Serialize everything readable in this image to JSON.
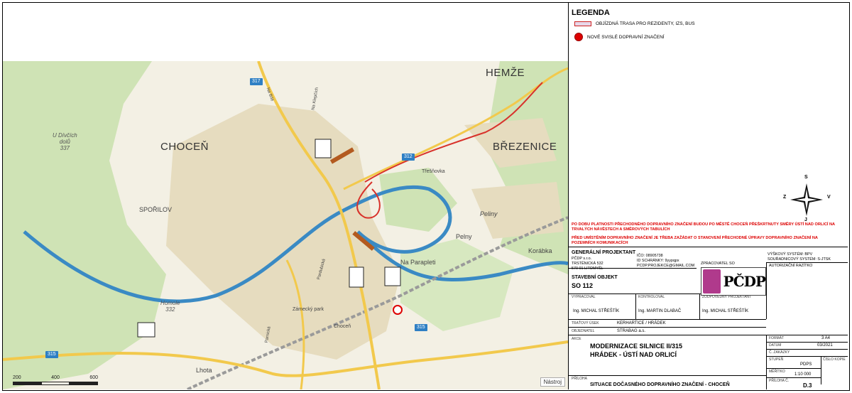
{
  "legend": {
    "title": "LEGENDA",
    "items": [
      {
        "label": "OBJÍZDNÁ TRASA PRO REZIDENTY, IZS, BUS"
      },
      {
        "label": "NOVÉ SVISLÉ DOPRAVNÍ ZNAČENÍ"
      }
    ]
  },
  "compass": {
    "z": "Z",
    "v": "V",
    "s": "S",
    "j": "J"
  },
  "notes": [
    "PO DOBU PLATNOSTI PŘECHODNÉHO DOPRAVNÍHO ZNAČENÍ BUDOU PO MĚSTĚ CHOCEŇ PŘEŠKRTNUTY SMĚRY ÚSTÍ NAD ORLICÍ NA TRVALÝCH NÁVĚSTECH A SMĚROVÝCH TABULÍCH",
    "PŘED UMÍSTĚNÍM DOPRAVNÍHO ZNAČENÍ JE TŘEBA ZAŽÁDAT O STANOVENÍ PŘECHODNÉ ÚPRAVY DOPRAVNÍHO ZNAČENÍ NA POZEMNÍCH KOMUNIKACÍCH"
  ],
  "title_block": {
    "gp_label": "GENERÁLNÍ PROJEKTANT",
    "gp_lines": [
      "PČDP s.r.o.",
      "TRSTĚNICKÁ 532",
      "570 01 LITOMYŠL"
    ],
    "ico": "IČO: 08905738",
    "ds": "ID SCHRÁNKY: 9yypqpx",
    "email": "PCDP.PROJEKCE@GMAIL.COM",
    "zprac": "ZPRACOVATEL SO",
    "vys": "VÝŠKOVÝ SYSTÉM: BPV",
    "sour": "SOUŘADNICOVÝ SYSTÉM: S-JTSK",
    "razitko": "AUTORIZAČNÍ RAZÍTKO",
    "logo_text": "PČDP",
    "so_label": "STAVEBNÍ OBJEKT",
    "so_value": "SO 112",
    "vypracoval_lbl": "VYPRACOVAL",
    "vypracoval": "Ing. MICHAL STŘEŠTÍK",
    "kontroloval_lbl": "KONTROLOVAL",
    "kontroloval": "Ing. MARTIN DLABAČ",
    "zodp_lbl": "ZODPOVĚDNÝ PROJEKTANT",
    "zodp": "Ing. MICHAL STŘEŠTÍK",
    "tratovy_lbl": "TRAŤOVÝ ÚSEK",
    "tratovy": "KERHARTICE / HRÁDEK",
    "objednatel_lbl": "OBJEDNATEL",
    "objednatel": "STRABAG a.s.",
    "akce_lbl": "AKCE",
    "akce_1": "MODERNIZACE SILNICE II/315",
    "akce_2": "HRÁDEK - ÚSTÍ NAD ORLICÍ",
    "format_lbl": "FORMÁT",
    "format": "3 A4",
    "datum_lbl": "DATUM",
    "datum": "03/2021",
    "zakazky_lbl": "Č. ZAKÁZKY",
    "stupen_lbl": "STUPEŇ",
    "stupen": "PDPS",
    "kopie_lbl": "ČÍSLO KOPIE",
    "meritko_lbl": "MĚŘÍTKO",
    "meritko": "1:10 000",
    "priloha_c_lbl": "PŘÍLOHA Č.",
    "priloha_c": "D.3",
    "priloha_lbl": "PŘÍLOHA",
    "priloha": "SITUACE DOČASNÉHO DOPRAVNÍHO ZNAČENÍ - CHOCEŇ"
  },
  "map": {
    "places": {
      "chocen": "CHOCEŇ",
      "hemze": "HEMŽE",
      "brezenice": "BŘEZENICE",
      "sporilov": "SPOŘILOV",
      "lhota": "Lhota",
      "pelny": "Pelny",
      "pelinky": "Peliny",
      "korabka": "Korábka",
      "na_parapleti": "Na Parapleti",
      "tresnovka": "Třešňovka",
      "zamecky_park": "Zámecký park",
      "chocen_station": "Choceň",
      "u_divcich_1": "U Dívčích",
      "u_divcich_2": "dolů",
      "u_divcich_3": "337",
      "homole_1": "Homole",
      "homole_2": "332",
      "na_bile": "Na Bílé",
      "na_klepcich": "Na Klepčích",
      "pardubicka": "Pardubická",
      "parnicka": "Parnická"
    },
    "routes": {
      "r317": "317",
      "r312": "312",
      "r315a": "315",
      "r315b": "315"
    },
    "scale_labels": [
      "200",
      "400",
      "600"
    ],
    "tools_label": "Nástroj"
  },
  "colors": {
    "river": "#3a8ac4",
    "forest": "#c9dfb0",
    "town": "#e6dcc0",
    "road": "#f2c94c",
    "detour": "#d8322b",
    "accent": "#b03a8c"
  }
}
